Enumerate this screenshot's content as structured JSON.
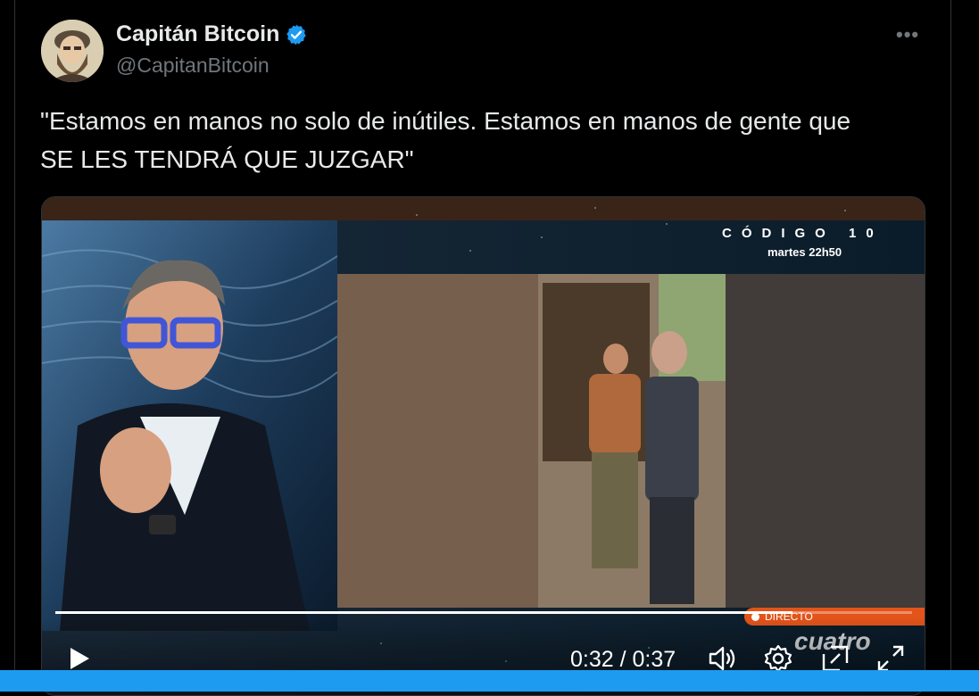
{
  "author": {
    "name": "Capitán Bitcoin",
    "handle": "@CapitanBitcoin",
    "verified_icon": "verified-badge-icon",
    "avatar_icon": "avatar-illustration"
  },
  "more_label": "•••",
  "tweet": {
    "text_line1": "\"Estamos en manos no solo de inútiles. Estamos en manos de gente que",
    "text_line2": "SE LES TENDRÁ QUE JUZGAR\""
  },
  "video": {
    "overlay_title": "CÓDIGO 10",
    "overlay_time": "martes 22h50",
    "live_label": "DIRECTO",
    "channel_logo": "cuatro",
    "current_time": "0:32",
    "duration": "0:37",
    "time_display": "0:32 / 0:37",
    "progress": 0.86
  },
  "colors": {
    "accent": "#1d9bf0",
    "live": "#e3541a",
    "background": "#000000",
    "text_secondary": "#71767b"
  },
  "icons": [
    "play-icon",
    "volume-icon",
    "settings-gear-icon",
    "picture-in-picture-icon",
    "fullscreen-icon"
  ]
}
